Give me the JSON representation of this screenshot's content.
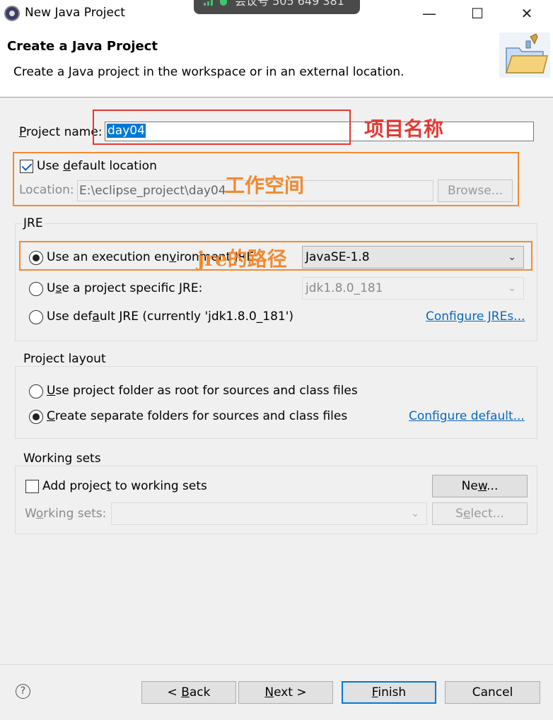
{
  "window": {
    "title": "New Java Project",
    "minimize_glyph": "—",
    "maximize_glyph": "☐",
    "close_glyph": "✕",
    "meeting_overlay": "会议号 505 649 381"
  },
  "header": {
    "title": "Create a Java Project",
    "description": "Create a Java project in the workspace or in an external location.",
    "icon": "java-project-folder-icon"
  },
  "project": {
    "name_label_pre": "",
    "name_label_mnemonic": "P",
    "name_label_post": "roject name:",
    "name_value": "day04"
  },
  "location": {
    "use_default_pre": "Use ",
    "use_default_mnemonic": "d",
    "use_default_post": "efault location",
    "use_default_checked": true,
    "label": "Location:",
    "value": "E:\\eclipse_project\\day04",
    "browse_label": "Browse..."
  },
  "jre": {
    "group_label": "JRE",
    "exec_env_pre": "Use an execution en",
    "exec_env_mnemonic": "v",
    "exec_env_post": "ironment JRE:",
    "exec_env_value": "JavaSE-1.8",
    "project_specific_pre": "U",
    "project_specific_mnemonic": "s",
    "project_specific_post": "e a project specific JRE:",
    "project_specific_value": "jdk1.8.0_181",
    "default_pre": "Use def",
    "default_mnemonic": "a",
    "default_post": "ult JRE (currently 'jdk1.8.0_181')",
    "configure_link": "Configure JREs..."
  },
  "layout": {
    "group_label": "Project layout",
    "option1_pre": "",
    "option1_mnemonic": "U",
    "option1_post": "se project folder as root for sources and class files",
    "option2_pre": "",
    "option2_mnemonic": "C",
    "option2_post": "reate separate folders for sources and class files",
    "configure_link": "Configure default..."
  },
  "working_sets": {
    "group_label": "Working sets",
    "add_label_pre": "Add projec",
    "add_label_mnemonic": "t",
    "add_label_post": " to working sets",
    "add_checked": false,
    "new_label_pre": "Ne",
    "new_label_mnemonic": "w",
    "new_label_post": "...",
    "sets_label_pre": "W",
    "sets_label_mnemonic": "o",
    "sets_label_post": "rking sets:",
    "select_label_pre": "S",
    "select_label_mnemonic": "e",
    "select_label_post": "lect..."
  },
  "footer": {
    "help_glyph": "?",
    "back_pre": "< ",
    "back_mnemonic": "B",
    "back_post": "ack",
    "next_pre": "",
    "next_mnemonic": "N",
    "next_post": "ext >",
    "finish_pre": "",
    "finish_mnemonic": "F",
    "finish_post": "inish",
    "cancel_label": "Cancel"
  },
  "annotations": {
    "project_name_note": "项目名称",
    "workspace_note": "工作空间",
    "jre_path_note": "jre的路径",
    "red": "#e53935",
    "orange": "#f28a2e"
  }
}
